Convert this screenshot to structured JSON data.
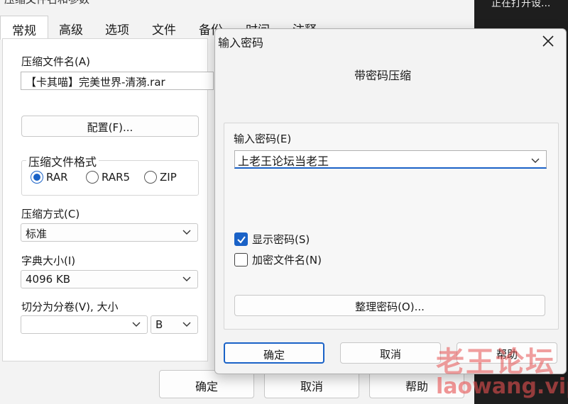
{
  "window": {
    "title": "压缩文件名和参数"
  },
  "right_strip": {
    "text": "正在打开设..."
  },
  "tabs": [
    {
      "label": "常规",
      "active": true
    },
    {
      "label": "高级",
      "active": false
    },
    {
      "label": "选项",
      "active": false
    },
    {
      "label": "文件",
      "active": false
    },
    {
      "label": "备份",
      "active": false
    },
    {
      "label": "时间",
      "active": false
    },
    {
      "label": "注释",
      "active": false
    }
  ],
  "general": {
    "archive_name_label": "压缩文件名(A)",
    "archive_name_value": "【卡其喵】完美世界-清漪.rar",
    "profiles_button": "配置(F)...",
    "format_group_title": "压缩文件格式",
    "formats": [
      {
        "label": "RAR",
        "selected": true
      },
      {
        "label": "RAR5",
        "selected": false
      },
      {
        "label": "ZIP",
        "selected": false
      }
    ],
    "method_label": "压缩方式(C)",
    "method_value": "标准",
    "dict_label": "字典大小(I)",
    "dict_value": "4096 KB",
    "split_label": "切分为分卷(V), 大小",
    "split_value": "",
    "split_unit": "B"
  },
  "bottom_buttons": {
    "ok": "确定",
    "cancel": "取消",
    "help": "帮助"
  },
  "dialog": {
    "title": "输入密码",
    "header": "带密码压缩",
    "password_label": "输入密码(E)",
    "password_value": "上老王论坛当老王",
    "show_password_label": "显示密码(S)",
    "show_password_checked": true,
    "encrypt_names_label": "加密文件名(N)",
    "encrypt_names_checked": false,
    "manage_button": "整理密码(O)...",
    "ok": "确定",
    "cancel": "取消",
    "help": "帮助"
  },
  "watermark": {
    "line1": "老王论坛",
    "line2": "laowang.vip"
  },
  "colors": {
    "accent": "#1a62c7",
    "watermark": "#e65050"
  }
}
